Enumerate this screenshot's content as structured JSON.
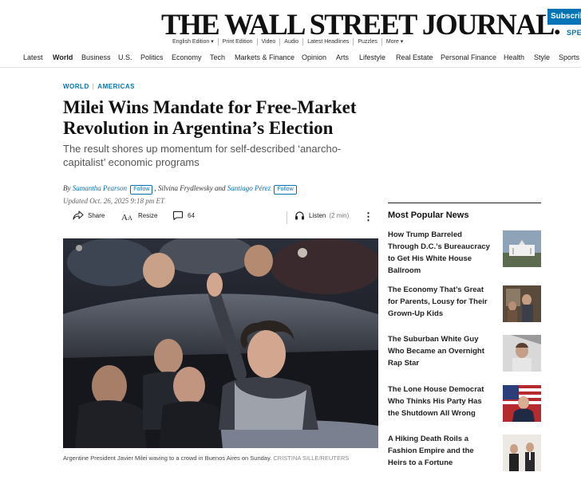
{
  "masthead": {
    "logo": "THE WALL STREET JOURNAL.",
    "subscribe_label": "Subscribe",
    "sign_label": "SPE",
    "editions": [
      "English Edition ▾",
      "Print Edition",
      "Video",
      "Audio",
      "Latest Headlines",
      "Puzzles",
      "More ▾"
    ]
  },
  "nav": {
    "items": [
      "Latest",
      "World",
      "Business",
      "U.S.",
      "Politics",
      "Economy",
      "Tech",
      "Markets & Finance",
      "Opinion",
      "Arts",
      "Lifestyle",
      "Real Estate",
      "Personal Finance",
      "Health",
      "Style",
      "Sports"
    ],
    "active": "World"
  },
  "article": {
    "breadcrumb": [
      "WORLD",
      "AMERICAS"
    ],
    "headline": "Milei Wins Mandate for Free-Market Revolution in Argentina’s Election",
    "dek": "The result shores up momentum for self-described ‘anarcho-capitalist’ economic programs",
    "byline": {
      "by": "By",
      "author1": "Samantha Pearson",
      "follow": "Follow",
      "middle": ", Silvina Frydlewsky and",
      "author2": "Santiago Pérez"
    },
    "updated": "Updated Oct. 26, 2025 9:18 pm ET",
    "tools": {
      "share": "Share",
      "resize": "Resize",
      "comments": "64",
      "listen": "Listen",
      "listen_time": "(2 min)",
      "more": "⋮"
    },
    "caption": "Argentine President Javier Milei waving to a crowd in Buenos Aires on Sunday.",
    "credit": "CRISTINA SILLE/REUTERS"
  },
  "sidebar": {
    "title": "Most Popular News",
    "items": [
      {
        "text": "How Trump Barreled Through D.C.’s Bureaucracy to Get His White House Ballroom"
      },
      {
        "text": "The Economy That’s Great for Parents, Lousy for Their Grown-Up Kids"
      },
      {
        "text": "The Suburban White Guy Who Became an Overnight Rap Star"
      },
      {
        "text": "The Lone House Democrat Who Thinks His Party Has the Shutdown All Wrong"
      },
      {
        "text": "A Hiking Death Roils a Fashion Empire and the Heirs to a Fortune"
      }
    ]
  },
  "colors": {
    "accent": "#0274b6",
    "text": "#111111",
    "muted": "#555555"
  }
}
